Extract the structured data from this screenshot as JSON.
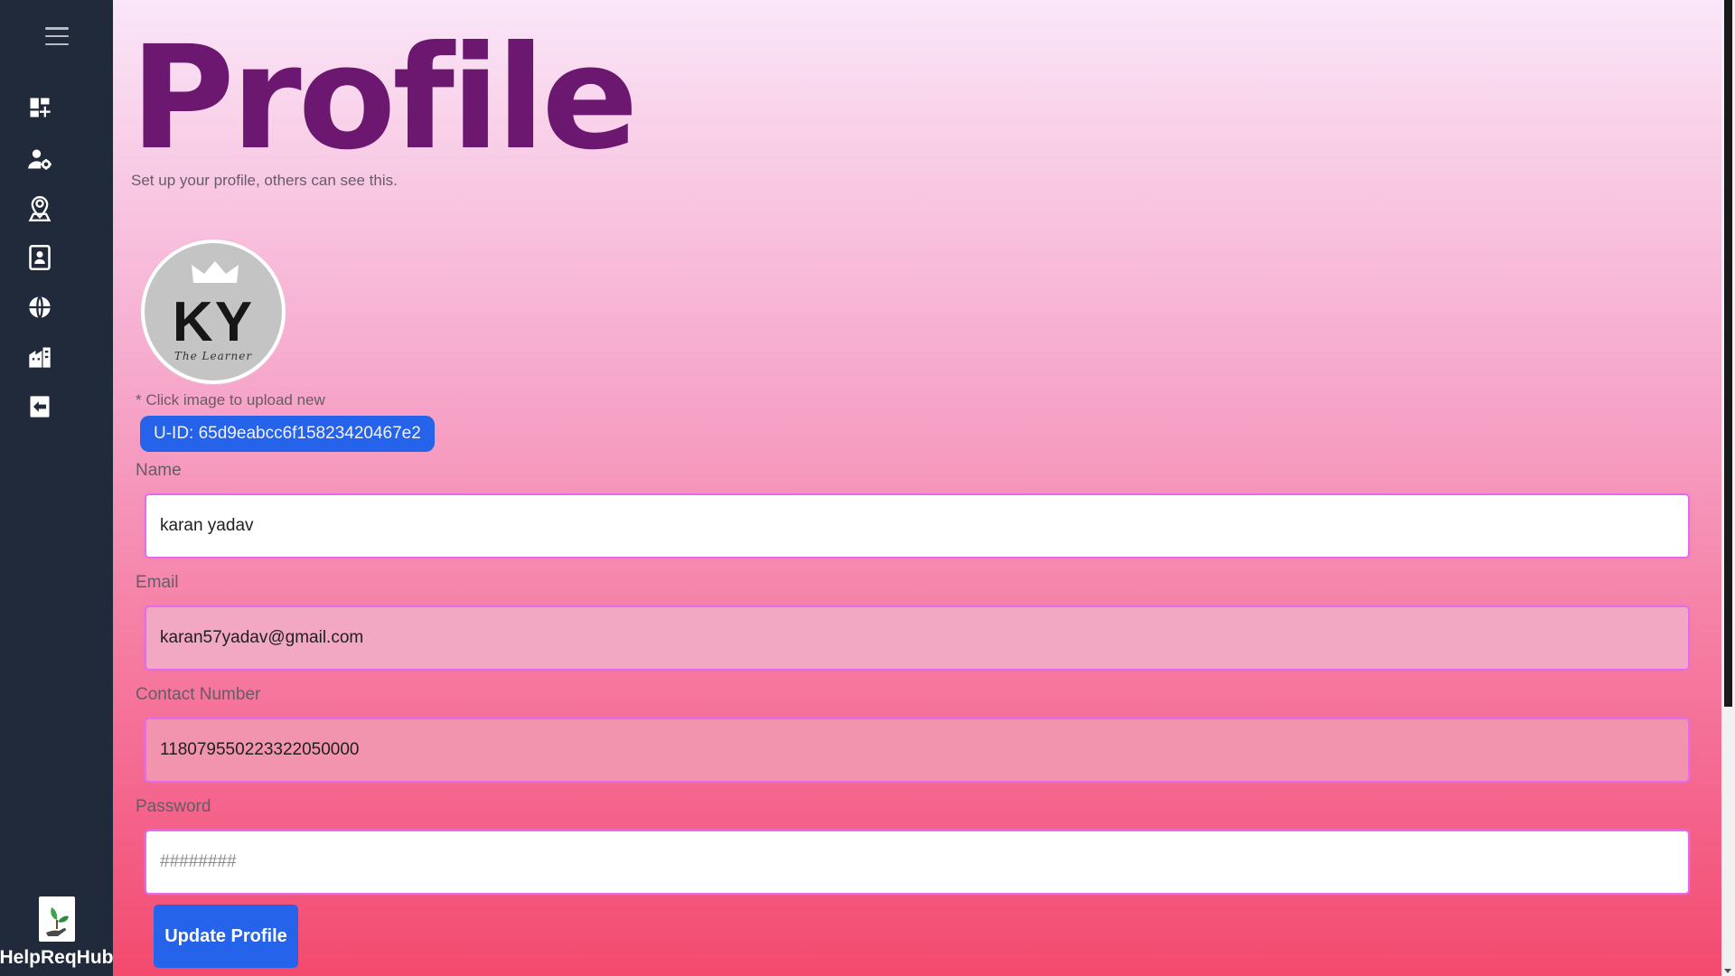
{
  "sidebar": {
    "menu_icon": "hamburger-menu-icon",
    "items": [
      {
        "icon": "dashboard-add-icon"
      },
      {
        "icon": "user-settings-icon"
      },
      {
        "icon": "location-person-icon"
      },
      {
        "icon": "contact-card-icon"
      },
      {
        "icon": "globe-icon"
      },
      {
        "icon": "building-icon"
      },
      {
        "icon": "logout-arrow-icon"
      }
    ],
    "brand_name": "HelpReqHub",
    "brand_logo": "plant-hand-logo-icon",
    "background": "#212a3a"
  },
  "header": {
    "title": "Profile",
    "subtitle": "Set up your profile, others can see this."
  },
  "avatar": {
    "initials": "KY",
    "caption": "The Learner",
    "hint": "* Click image to upload new"
  },
  "uid": {
    "label": "U-ID: 65d9eabcc6f15823420467e2"
  },
  "form": {
    "name_label": "Name",
    "name_value": "karan yadav",
    "email_label": "Email",
    "email_value": "karan57yadav@gmail.com",
    "contact_label": "Contact Number",
    "contact_value": "118079550223322050000",
    "password_label": "Password",
    "password_placeholder": "########",
    "submit_label": "Update Profile"
  },
  "colors": {
    "accent": "#2563eb",
    "title": "#6d1870",
    "input_border": "#e46ce8"
  }
}
